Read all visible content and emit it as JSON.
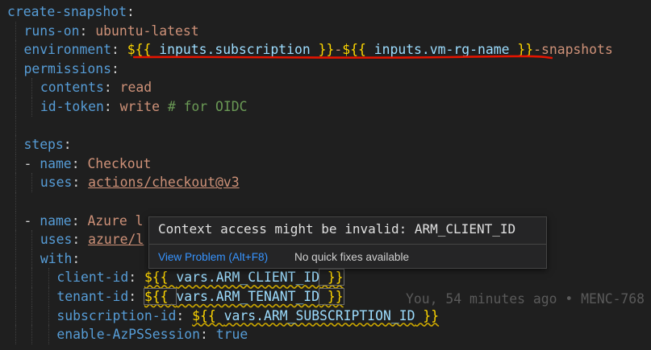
{
  "editor": {
    "lines": [
      {
        "indent": 0,
        "guides": [],
        "tokens": [
          {
            "t": "create-snapshot",
            "c": "k"
          },
          {
            "t": ":",
            "c": "p"
          }
        ]
      },
      {
        "indent": 1,
        "guides": [
          1
        ],
        "tokens": [
          {
            "t": "runs-on",
            "c": "k"
          },
          {
            "t": ": ",
            "c": "p"
          },
          {
            "t": "ubuntu-latest",
            "c": "v"
          }
        ]
      },
      {
        "indent": 1,
        "guides": [
          1
        ],
        "tokens": [
          {
            "t": "environment",
            "c": "k"
          },
          {
            "t": ": ",
            "c": "p"
          },
          {
            "t": "${{ ",
            "c": "e"
          },
          {
            "t": "inputs.subscription",
            "c": "i"
          },
          {
            "t": " }}",
            "c": "e"
          },
          {
            "t": "-",
            "c": "v"
          },
          {
            "t": "${{ ",
            "c": "e"
          },
          {
            "t": "inputs.vm-rg-name",
            "c": "i"
          },
          {
            "t": " }}",
            "c": "e"
          },
          {
            "t": "-snapshots",
            "c": "v"
          }
        ]
      },
      {
        "indent": 1,
        "guides": [
          1
        ],
        "tokens": [
          {
            "t": "permissions",
            "c": "k"
          },
          {
            "t": ":",
            "c": "p"
          }
        ]
      },
      {
        "indent": 2,
        "guides": [
          1,
          2
        ],
        "tokens": [
          {
            "t": "contents",
            "c": "k"
          },
          {
            "t": ": ",
            "c": "p"
          },
          {
            "t": "read",
            "c": "v"
          }
        ]
      },
      {
        "indent": 2,
        "guides": [
          1,
          2
        ],
        "tokens": [
          {
            "t": "id-token",
            "c": "k"
          },
          {
            "t": ": ",
            "c": "p"
          },
          {
            "t": "write",
            "c": "v"
          },
          {
            "t": " ",
            "c": "p"
          },
          {
            "t": "# for OIDC",
            "c": "c"
          }
        ]
      },
      {
        "indent": 0,
        "guides": [
          1
        ],
        "tokens": []
      },
      {
        "indent": 1,
        "guides": [
          1
        ],
        "tokens": [
          {
            "t": "steps",
            "c": "k"
          },
          {
            "t": ":",
            "c": "p"
          }
        ]
      },
      {
        "indent": 1,
        "guides": [
          1
        ],
        "tokens": [
          {
            "t": "- ",
            "c": "p"
          },
          {
            "t": "name",
            "c": "k"
          },
          {
            "t": ": ",
            "c": "p"
          },
          {
            "t": "Checkout",
            "c": "v"
          }
        ]
      },
      {
        "indent": 2,
        "guides": [
          1,
          2
        ],
        "tokens": [
          {
            "t": "uses",
            "c": "k"
          },
          {
            "t": ": ",
            "c": "p"
          },
          {
            "t": "actions/checkout@v3",
            "c": "v u"
          }
        ]
      },
      {
        "indent": 0,
        "guides": [
          1
        ],
        "tokens": []
      },
      {
        "indent": 1,
        "guides": [
          1
        ],
        "tokens": [
          {
            "t": "- ",
            "c": "p"
          },
          {
            "t": "name",
            "c": "k"
          },
          {
            "t": ": ",
            "c": "p"
          },
          {
            "t": "Azure l",
            "c": "v"
          }
        ]
      },
      {
        "indent": 2,
        "guides": [
          1,
          2
        ],
        "tokens": [
          {
            "t": "uses",
            "c": "k"
          },
          {
            "t": ": ",
            "c": "p"
          },
          {
            "t": "azure/l",
            "c": "v u"
          }
        ]
      },
      {
        "indent": 2,
        "guides": [
          1,
          2
        ],
        "tokens": [
          {
            "t": "with",
            "c": "k"
          },
          {
            "t": ":",
            "c": "p"
          }
        ]
      },
      {
        "indent": 3,
        "guides": [
          1,
          2,
          3
        ],
        "tokens": [
          {
            "t": "client-id",
            "c": "k"
          },
          {
            "t": ": ",
            "c": "p"
          },
          {
            "t": "${{ ",
            "c": "e warn"
          },
          {
            "t": "vars.ARM_CLIENT_ID",
            "c": "i warn"
          },
          {
            "t": " }}",
            "c": "e warn box"
          }
        ]
      },
      {
        "indent": 3,
        "guides": [
          1,
          2,
          3
        ],
        "tokens": [
          {
            "t": "tenant-id",
            "c": "k"
          },
          {
            "t": ": ",
            "c": "p"
          },
          {
            "t": "${{ ",
            "c": "e warn box"
          },
          {
            "t": "vars.ARM_TENANT_ID",
            "c": "i warn"
          },
          {
            "t": " }}",
            "c": "e warn box"
          }
        ]
      },
      {
        "indent": 3,
        "guides": [
          1,
          2,
          3
        ],
        "tokens": [
          {
            "t": "subscription-id",
            "c": "k"
          },
          {
            "t": ": ",
            "c": "p"
          },
          {
            "t": "${{ ",
            "c": "e warn"
          },
          {
            "t": "vars.ARM_SUBSCRIPTION_ID",
            "c": "i warn"
          },
          {
            "t": " }}",
            "c": "e warn"
          }
        ]
      },
      {
        "indent": 3,
        "guides": [
          1,
          2,
          3
        ],
        "tokens": [
          {
            "t": "enable-AzPSSession",
            "c": "k"
          },
          {
            "t": ": ",
            "c": "p"
          },
          {
            "t": "true",
            "c": "k"
          }
        ]
      }
    ],
    "blame": "You, 54 minutes ago • MENC-768"
  },
  "hover": {
    "message": "Context access might be invalid: ARM_CLIENT_ID",
    "view_problem": "View Problem (Alt+F8)",
    "no_fixes": "No quick fixes available"
  },
  "colors": {
    "background": "#1f1f1f",
    "key": "#569cd6",
    "string": "#ce9178",
    "expression_brace": "#ffd700",
    "expression_var": "#9cdcfe",
    "comment": "#6a9955",
    "warning_squiggle": "#cca700",
    "annotation_underline": "#e51400",
    "link": "#3794ff"
  }
}
